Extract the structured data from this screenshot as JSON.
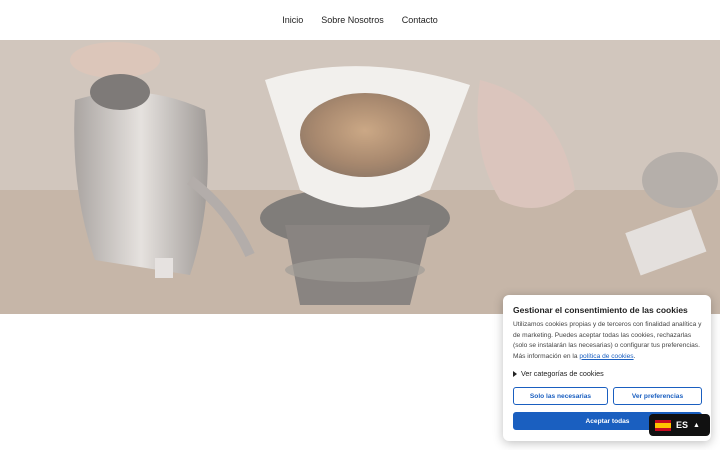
{
  "nav": {
    "items": [
      "Inicio",
      "Sobre Nosotros",
      "Contacto"
    ]
  },
  "hero": {
    "image": "coffee-pour-over-photo"
  },
  "cookie_banner": {
    "title": "Gestionar el consentimiento de las cookies",
    "description": "Utilizamos cookies propias y de terceros con finalidad analítica y de marketing. Puedes aceptar todas las cookies, rechazarlas (solo se instalarán las necesarias) o configurar tus preferencias. Más información en la ",
    "policy_link": "política de cookies",
    "description_end": ".",
    "categories_toggle": "Ver categorías de cookies",
    "btn_necessary": "Solo las necesarias",
    "btn_preferences": "Ver preferencias",
    "btn_accept": "Aceptar todas",
    "accent_color": "#1a5fc0"
  },
  "language_switcher": {
    "code": "ES",
    "flag_icon": "spain-flag-icon",
    "chevron_icon": "chevron-up-icon"
  }
}
